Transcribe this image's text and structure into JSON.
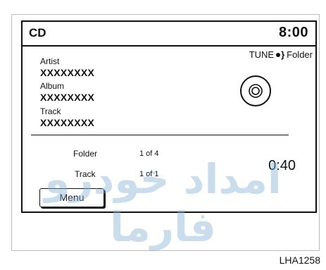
{
  "header": {
    "source": "CD",
    "clock": "8:00"
  },
  "tune": {
    "prefix": "TUNE",
    "suffix": "Folder"
  },
  "track_info": [
    {
      "label": "Artist",
      "value": "XXXXXXXX"
    },
    {
      "label": "Album",
      "value": "XXXXXXXX"
    },
    {
      "label": "Track",
      "value": "XXXXXXXX"
    }
  ],
  "status": {
    "folder_label": "Folder",
    "folder_value": "1 of 4",
    "track_label": "Track",
    "track_value": "1 of 1",
    "time": "0:40"
  },
  "menu_label": "Menu",
  "watermark": "امداد خودرو فارما",
  "figure_code": "LHA1258",
  "icons": [
    "disc-icon",
    "tune-knob-icon"
  ]
}
